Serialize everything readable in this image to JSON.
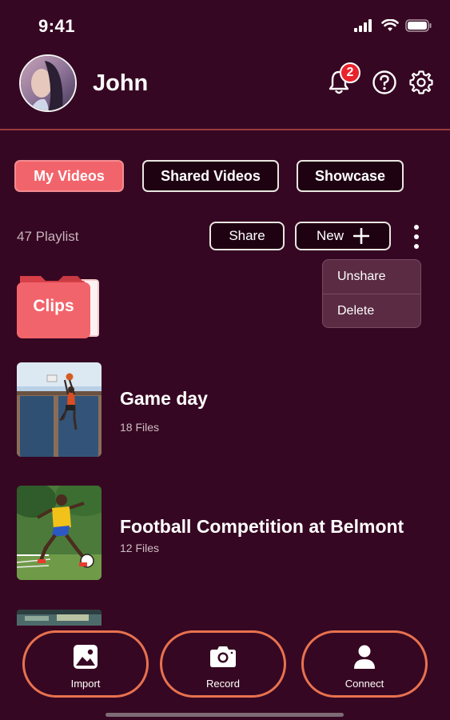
{
  "status_bar": {
    "time": "9:41"
  },
  "header": {
    "username": "John",
    "notification_count": "2"
  },
  "tabs": [
    {
      "label": "My Videos",
      "active": true
    },
    {
      "label": "Shared Videos",
      "active": false
    },
    {
      "label": "Showcase",
      "active": false
    }
  ],
  "toolbar": {
    "playlist_count": "47 Playlist",
    "share_label": "Share",
    "new_label": "New"
  },
  "context_menu": {
    "items": [
      "Unshare",
      "Delete"
    ]
  },
  "folder": {
    "label": "Clips"
  },
  "playlists": [
    {
      "title": "Game day",
      "files": "18 Files"
    },
    {
      "title": "Football Competition at Belmont",
      "files": "12 Files"
    }
  ],
  "bottom_nav": [
    {
      "label": "Import",
      "icon": "image-icon"
    },
    {
      "label": "Record",
      "icon": "camera-icon"
    },
    {
      "label": "Connect",
      "icon": "person-icon"
    }
  ],
  "colors": {
    "background": "#360722",
    "accent": "#f2646b",
    "outline": "#e8724f",
    "badge": "#e8232c"
  }
}
